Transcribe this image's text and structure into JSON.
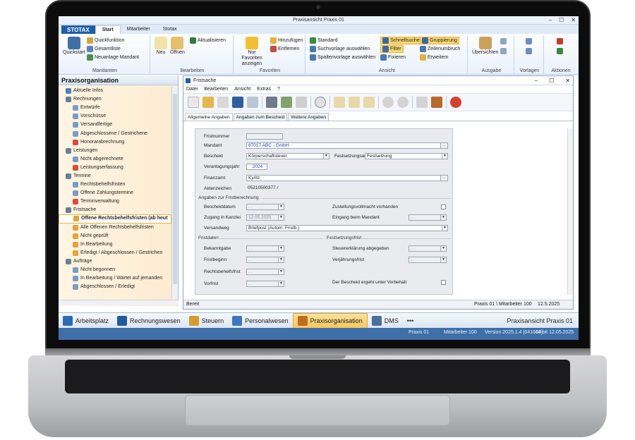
{
  "app": {
    "window_title": "Praxisansicht Praxis 01",
    "window_controls": [
      "–",
      "☐",
      "✕"
    ]
  },
  "ribbon": {
    "logo": "STOTAX",
    "tabs": [
      "Start",
      "Mitarbeiter",
      "Stotax"
    ],
    "groups": {
      "mandanten": {
        "label": "Mandanten",
        "quickstart": "Quickstart",
        "quickfunktion": "Quickfunktion",
        "gesamtliste": "Gesamtliste",
        "neuanlage": "Neuanlage Mandant"
      },
      "bearbeiten": {
        "label": "Bearbeiten",
        "neu": "Neu",
        "oeffnen": "Öffnen",
        "aktualisieren": "Aktualisieren"
      },
      "favoriten": {
        "label": "Favoriten",
        "nur_favoriten": "Nur Favoriten anzeigen",
        "hinzufuegen": "Hinzufügen",
        "entfernen": "Entfernen"
      },
      "ansicht": {
        "label": "Ansicht",
        "standard": "Standard",
        "suchvorlage": "Suchvorlage auswählen",
        "spaltenvorlage": "Spaltenvorlage auswählen",
        "schnellsuche": "Schnellsuche",
        "filter": "Filter",
        "fixieren": "Fixieren",
        "gruppierung": "Gruppierung",
        "zeilenumbruch": "Zeilenumbruch",
        "erweitern": "Erweitern"
      },
      "ausgabe": {
        "label": "Ausgabe",
        "uebersichten": "Übersichten"
      },
      "vorlagen": {
        "label": "Vorlagen"
      },
      "aktionen": {
        "label": "Aktionen"
      }
    }
  },
  "nav": {
    "title": "Praxisorganisation",
    "items": [
      {
        "label": "Aktuelle Infos",
        "level": 0,
        "color": "#4a7fc1"
      },
      {
        "label": "Rechnungen",
        "level": 0,
        "color": "#6a7f95"
      },
      {
        "label": "Entwürfe",
        "level": 1,
        "color": "#7a9cc7"
      },
      {
        "label": "Vorschüsse",
        "level": 1,
        "color": "#7a9cc7"
      },
      {
        "label": "Versandfertige",
        "level": 1,
        "color": "#7a9cc7"
      },
      {
        "label": "Abgeschlossene / Gestrichene",
        "level": 1,
        "color": "#7a9cc7"
      },
      {
        "label": "Honorarabrechnung",
        "level": 1,
        "color": "#e2483a"
      },
      {
        "label": "Leistungen",
        "level": 0,
        "color": "#6a7f95"
      },
      {
        "label": "Nicht abgerechnete",
        "level": 1,
        "color": "#7a9cc7"
      },
      {
        "label": "Leistungserfassung",
        "level": 1,
        "color": "#e2483a"
      },
      {
        "label": "Termine",
        "level": 0,
        "color": "#6a7f95"
      },
      {
        "label": "Rechtsbehelfsfristen",
        "level": 1,
        "color": "#7a9cc7"
      },
      {
        "label": "Offene Zahlungstermine",
        "level": 1,
        "color": "#7a9cc7"
      },
      {
        "label": "Terminverwaltung",
        "level": 1,
        "color": "#e2483a"
      },
      {
        "label": "Fristsache",
        "level": 0,
        "color": "#6a7f95"
      },
      {
        "label": "Offene Rechtsbehelfsfristen (ab heut",
        "level": 1,
        "color": "#e8a23a",
        "selected": true
      },
      {
        "label": "Alle Offenen Rechtsbehelfsfristen",
        "level": 1,
        "color": "#e8a23a"
      },
      {
        "label": "Nicht geprüft",
        "level": 1,
        "color": "#e8a23a"
      },
      {
        "label": "In Bearbeitung",
        "level": 1,
        "color": "#e8a23a"
      },
      {
        "label": "Erledigt / Abgeschlossen / Gestrichen",
        "level": 1,
        "color": "#e8a23a"
      },
      {
        "label": "Aufträge",
        "level": 0,
        "color": "#6a7f95"
      },
      {
        "label": "Nicht begonnen",
        "level": 1,
        "color": "#7a9cc7"
      },
      {
        "label": "In Bearbeitung / Wartet auf jemanden",
        "level": 1,
        "color": "#7a9cc7"
      },
      {
        "label": "Abgeschlossen / Erledigt",
        "level": 1,
        "color": "#7a9cc7"
      }
    ]
  },
  "fristsache": {
    "title": "Fristsache",
    "menu": [
      "Datei",
      "Bearbeiten",
      "Ansicht",
      "Extras",
      "?"
    ],
    "tabs": [
      "Allgemeine Angaben",
      "Angaben zum Bescheid",
      "Weitere Angaben"
    ],
    "fields": {
      "fristnummer": {
        "label": "Fristnummer",
        "value": ""
      },
      "mandant": {
        "label": "Mandant",
        "value": "67017 ABC - GmbH",
        "button": "..."
      },
      "bescheid": {
        "label": "Bescheid",
        "value": "Körperschaftsteuer"
      },
      "festsetzungsart": {
        "label": "Festsetzungsart",
        "value": "Festsetzung"
      },
      "veranlagungsjahr": {
        "label": "Veranlagungsjahr",
        "value": "2024"
      },
      "finanzamt": {
        "label": "Finanzamt",
        "value": "Kyritz",
        "button": "..."
      },
      "aktenzeichen": {
        "label": "Aktenzeichen",
        "value": "05210500377 /"
      }
    },
    "fristberechnung": {
      "section": "Angaben zur Fristberechnung",
      "bescheiddatum": {
        "label": "Bescheiddatum",
        "value": ". ."
      },
      "zugang": {
        "label": "Zugang in Kanzlei",
        "value": "12.05.2025"
      },
      "versandweg": {
        "label": "Versandweg",
        "value": "Briefpost (Autom. Fristb.)"
      },
      "zustellung": {
        "label": "Zustellungsvollmacht vorhanden",
        "checked": false
      },
      "eingang": {
        "label": "Eingang beim Mandant",
        "value": ". ."
      }
    },
    "fristdaten": {
      "section": "Fristdaten",
      "bekanntgabe": {
        "label": "Bekanntgabe",
        "value": ". ."
      },
      "fristbeginn": {
        "label": "Fristbeginn",
        "value": ". ."
      },
      "rechtsbehelfsfrist": {
        "label": "Rechtsbehelfsfrist",
        "value": ". ."
      },
      "vorfrist": {
        "label": "Vorfrist",
        "value": ". ."
      }
    },
    "festsetzungsfrist": {
      "section": "Festsetzungsfrist",
      "steuererklaerung": {
        "label": "Steuererklärung abgegeben",
        "value": ". ."
      },
      "verjaehrungsfrist": {
        "label": "Verjährungsfrist",
        "value": ". ."
      },
      "vorbehalt": {
        "label": "Der Bescheid ergeht unter Vorbehalt",
        "checked": false
      }
    },
    "status": {
      "left": "Bereit",
      "praxis": "Praxis 01 \\ Mitarbeiter 100",
      "date": "12.5.2025"
    }
  },
  "bottom_nav": {
    "items": [
      {
        "label": "Arbeitsplatz",
        "color": "#2b6cb5"
      },
      {
        "label": "Rechnungswesen",
        "color": "#1e5a9e"
      },
      {
        "label": "Steuern",
        "color": "#d89a2a"
      },
      {
        "label": "Personalwesen",
        "color": "#3a77c2"
      },
      {
        "label": "Praxisorganisation",
        "color": "#c46a1e",
        "active": true
      },
      {
        "label": "DMS",
        "color": "#4a6f9c"
      }
    ],
    "more": "•••",
    "right_title": "Praxisansicht Praxis 01"
  },
  "statusbar": {
    "praxis": "Praxis 01",
    "mitarbeiter": "Mitarbeiter 100",
    "version": "Version 2025.1.4 [041610]",
    "build": "64 bit 12.05.2025"
  }
}
